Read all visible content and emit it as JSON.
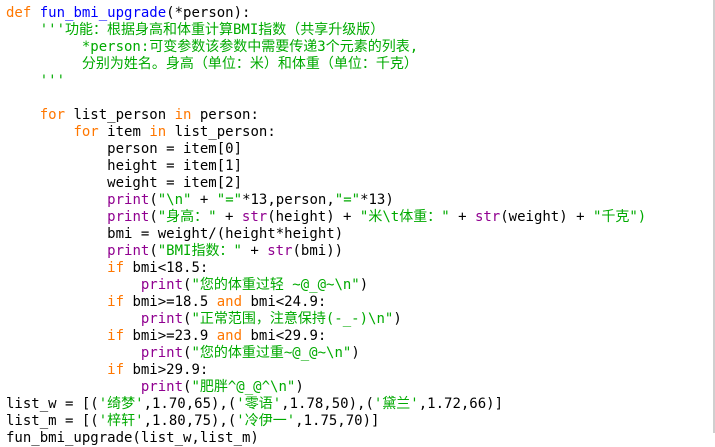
{
  "colors": {
    "keyword": "#ff7700",
    "function_name": "#0000ff",
    "builtin": "#900090",
    "string": "#00aa00",
    "default": "#000000",
    "background": "#ffffff"
  },
  "lines": [
    [
      {
        "t": "def",
        "c": "kw"
      },
      {
        "t": " ",
        "c": "tx"
      },
      {
        "t": "fun_bmi_upgrade",
        "c": "fn"
      },
      {
        "t": "(*person):",
        "c": "tx"
      }
    ],
    [
      {
        "t": "    '''功能：根据身高和体重计算BMI指数（共享升级版）",
        "c": "st"
      }
    ],
    [
      {
        "t": "         *person:可变参数该参数中需要传递3个元素的列表,",
        "c": "st"
      }
    ],
    [
      {
        "t": "         分别为姓名。身高（单位：米）和体重（单位：千克）",
        "c": "st"
      }
    ],
    [
      {
        "t": "    '''",
        "c": "st"
      }
    ],
    [],
    [
      {
        "t": "    ",
        "c": "tx"
      },
      {
        "t": "for",
        "c": "kw"
      },
      {
        "t": " list_person ",
        "c": "tx"
      },
      {
        "t": "in",
        "c": "kw"
      },
      {
        "t": " person:",
        "c": "tx"
      }
    ],
    [
      {
        "t": "        ",
        "c": "tx"
      },
      {
        "t": "for",
        "c": "kw"
      },
      {
        "t": " item ",
        "c": "tx"
      },
      {
        "t": "in",
        "c": "kw"
      },
      {
        "t": " list_person:",
        "c": "tx"
      }
    ],
    [
      {
        "t": "            person = item[0]",
        "c": "tx"
      }
    ],
    [
      {
        "t": "            height = item[1]",
        "c": "tx"
      }
    ],
    [
      {
        "t": "            weight = item[2]",
        "c": "tx"
      }
    ],
    [
      {
        "t": "            ",
        "c": "tx"
      },
      {
        "t": "print",
        "c": "bi"
      },
      {
        "t": "(",
        "c": "tx"
      },
      {
        "t": "\"\\n\"",
        "c": "st"
      },
      {
        "t": " + ",
        "c": "tx"
      },
      {
        "t": "\"=\"",
        "c": "st"
      },
      {
        "t": "*13,person,",
        "c": "tx"
      },
      {
        "t": "\"=\"",
        "c": "st"
      },
      {
        "t": "*13)",
        "c": "tx"
      }
    ],
    [
      {
        "t": "            ",
        "c": "tx"
      },
      {
        "t": "print",
        "c": "bi"
      },
      {
        "t": "(",
        "c": "tx"
      },
      {
        "t": "\"身高：\"",
        "c": "st"
      },
      {
        "t": " + ",
        "c": "tx"
      },
      {
        "t": "str",
        "c": "bi"
      },
      {
        "t": "(height) + ",
        "c": "tx"
      },
      {
        "t": "\"米\\t体重：\"",
        "c": "st"
      },
      {
        "t": " + ",
        "c": "tx"
      },
      {
        "t": "str",
        "c": "bi"
      },
      {
        "t": "(weight) + ",
        "c": "tx"
      },
      {
        "t": "\"千克\")",
        "c": "st"
      }
    ],
    [
      {
        "t": "            bmi = weight/(height*height)",
        "c": "tx"
      }
    ],
    [
      {
        "t": "            ",
        "c": "tx"
      },
      {
        "t": "print",
        "c": "bi"
      },
      {
        "t": "(",
        "c": "tx"
      },
      {
        "t": "\"BMI指数：\"",
        "c": "st"
      },
      {
        "t": " + ",
        "c": "tx"
      },
      {
        "t": "str",
        "c": "bi"
      },
      {
        "t": "(bmi))",
        "c": "tx"
      }
    ],
    [
      {
        "t": "            ",
        "c": "tx"
      },
      {
        "t": "if",
        "c": "kw"
      },
      {
        "t": " bmi<18.5:",
        "c": "tx"
      }
    ],
    [
      {
        "t": "                ",
        "c": "tx"
      },
      {
        "t": "print",
        "c": "bi"
      },
      {
        "t": "(",
        "c": "tx"
      },
      {
        "t": "\"您的体重过轻 ~@_@~\\n\"",
        "c": "st"
      },
      {
        "t": ")",
        "c": "tx"
      }
    ],
    [
      {
        "t": "            ",
        "c": "tx"
      },
      {
        "t": "if",
        "c": "kw"
      },
      {
        "t": " bmi>=18.5 ",
        "c": "tx"
      },
      {
        "t": "and",
        "c": "kw"
      },
      {
        "t": " bmi<24.9:",
        "c": "tx"
      }
    ],
    [
      {
        "t": "                ",
        "c": "tx"
      },
      {
        "t": "print",
        "c": "bi"
      },
      {
        "t": "(",
        "c": "tx"
      },
      {
        "t": "\"正常范围，注意保持(-_-)\\n\"",
        "c": "st"
      },
      {
        "t": ")",
        "c": "tx"
      }
    ],
    [
      {
        "t": "            ",
        "c": "tx"
      },
      {
        "t": "if",
        "c": "kw"
      },
      {
        "t": " bmi>=23.9 ",
        "c": "tx"
      },
      {
        "t": "and",
        "c": "kw"
      },
      {
        "t": " bmi<29.9:",
        "c": "tx"
      }
    ],
    [
      {
        "t": "                ",
        "c": "tx"
      },
      {
        "t": "print",
        "c": "bi"
      },
      {
        "t": "(",
        "c": "tx"
      },
      {
        "t": "\"您的体重过重~@_@~\\n\"",
        "c": "st"
      },
      {
        "t": ")",
        "c": "tx"
      }
    ],
    [
      {
        "t": "            ",
        "c": "tx"
      },
      {
        "t": "if",
        "c": "kw"
      },
      {
        "t": " bmi>29.9:",
        "c": "tx"
      }
    ],
    [
      {
        "t": "                ",
        "c": "tx"
      },
      {
        "t": "print",
        "c": "bi"
      },
      {
        "t": "(",
        "c": "tx"
      },
      {
        "t": "\"肥胖^@_@^\\n\"",
        "c": "st"
      },
      {
        "t": ")",
        "c": "tx"
      }
    ],
    [
      {
        "t": "list_w = [(",
        "c": "tx"
      },
      {
        "t": "'绮梦'",
        "c": "st"
      },
      {
        "t": ",1.70,65),(",
        "c": "tx"
      },
      {
        "t": "'零语'",
        "c": "st"
      },
      {
        "t": ",1.78,50),(",
        "c": "tx"
      },
      {
        "t": "'黛兰'",
        "c": "st"
      },
      {
        "t": ",1.72,66)]",
        "c": "tx"
      }
    ],
    [
      {
        "t": "list_m = [(",
        "c": "tx"
      },
      {
        "t": "'梓轩'",
        "c": "st"
      },
      {
        "t": ",1.80,75),(",
        "c": "tx"
      },
      {
        "t": "'冷伊一'",
        "c": "st"
      },
      {
        "t": ",1.75,70)]",
        "c": "tx"
      }
    ],
    [
      {
        "t": "fun_bmi_upgrade(list_w,list_m)",
        "c": "tx"
      }
    ]
  ]
}
